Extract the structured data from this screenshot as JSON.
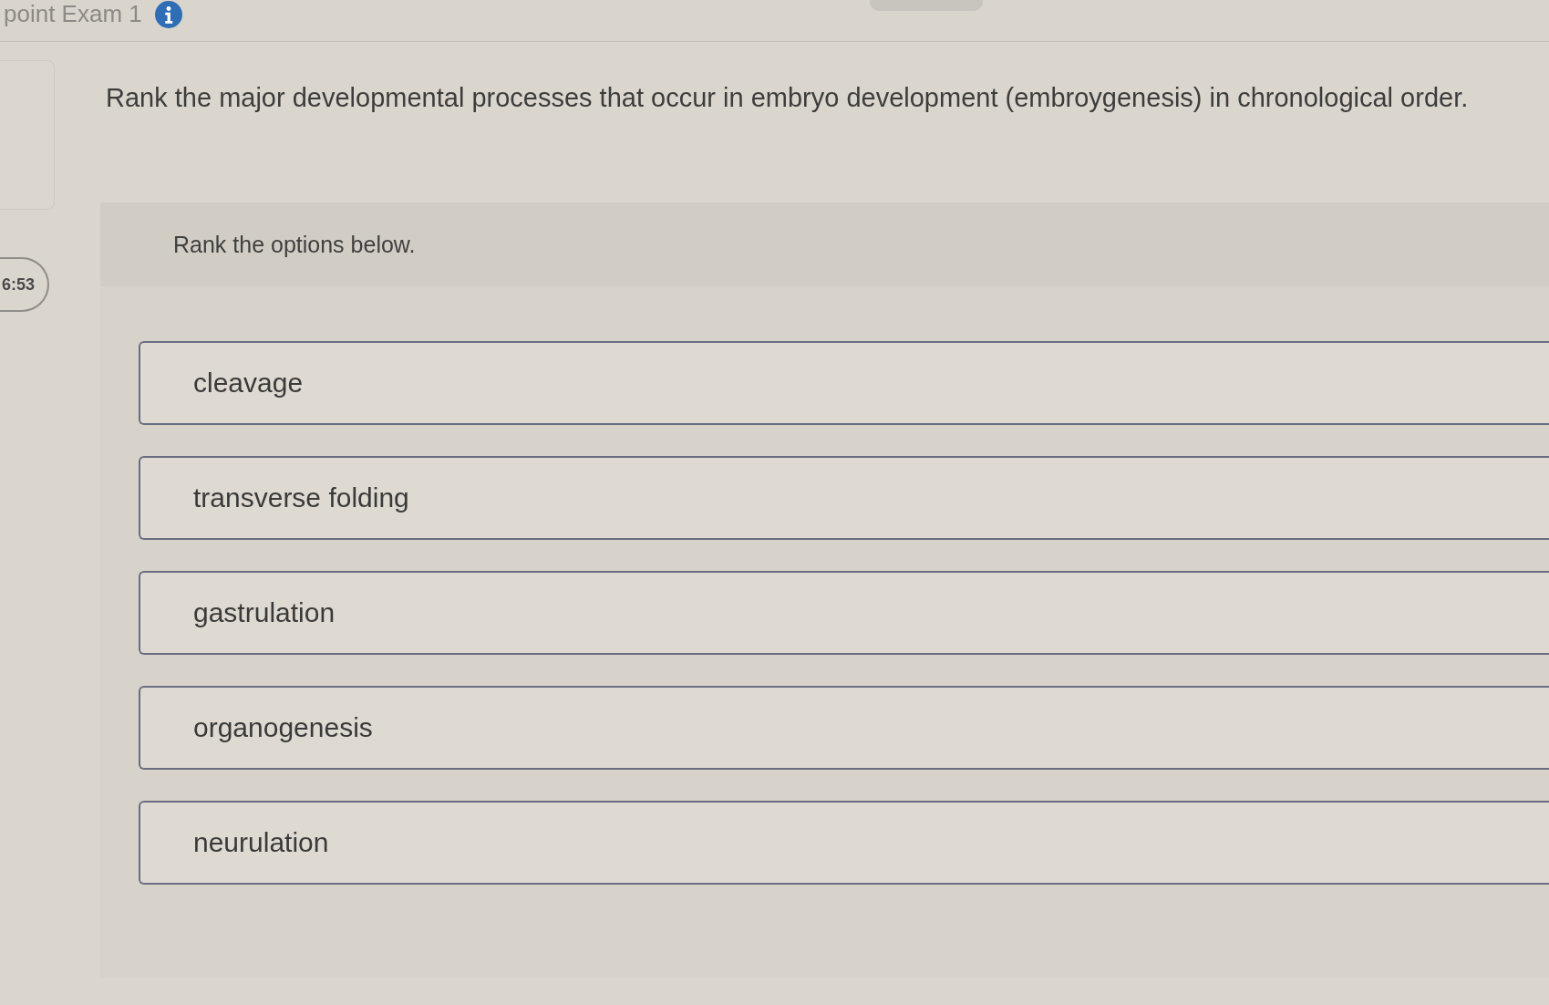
{
  "header": {
    "title": "point Exam 1"
  },
  "sidebar": {
    "timer": "6:53"
  },
  "question": {
    "prompt": "Rank the major developmental processes that occur in embryo development (embroygenesis) in chronological order.",
    "instruction": "Rank the options below.",
    "options": [
      {
        "label": "cleavage"
      },
      {
        "label": "transverse folding"
      },
      {
        "label": "gastrulation"
      },
      {
        "label": "organogenesis"
      },
      {
        "label": "neurulation"
      }
    ]
  }
}
